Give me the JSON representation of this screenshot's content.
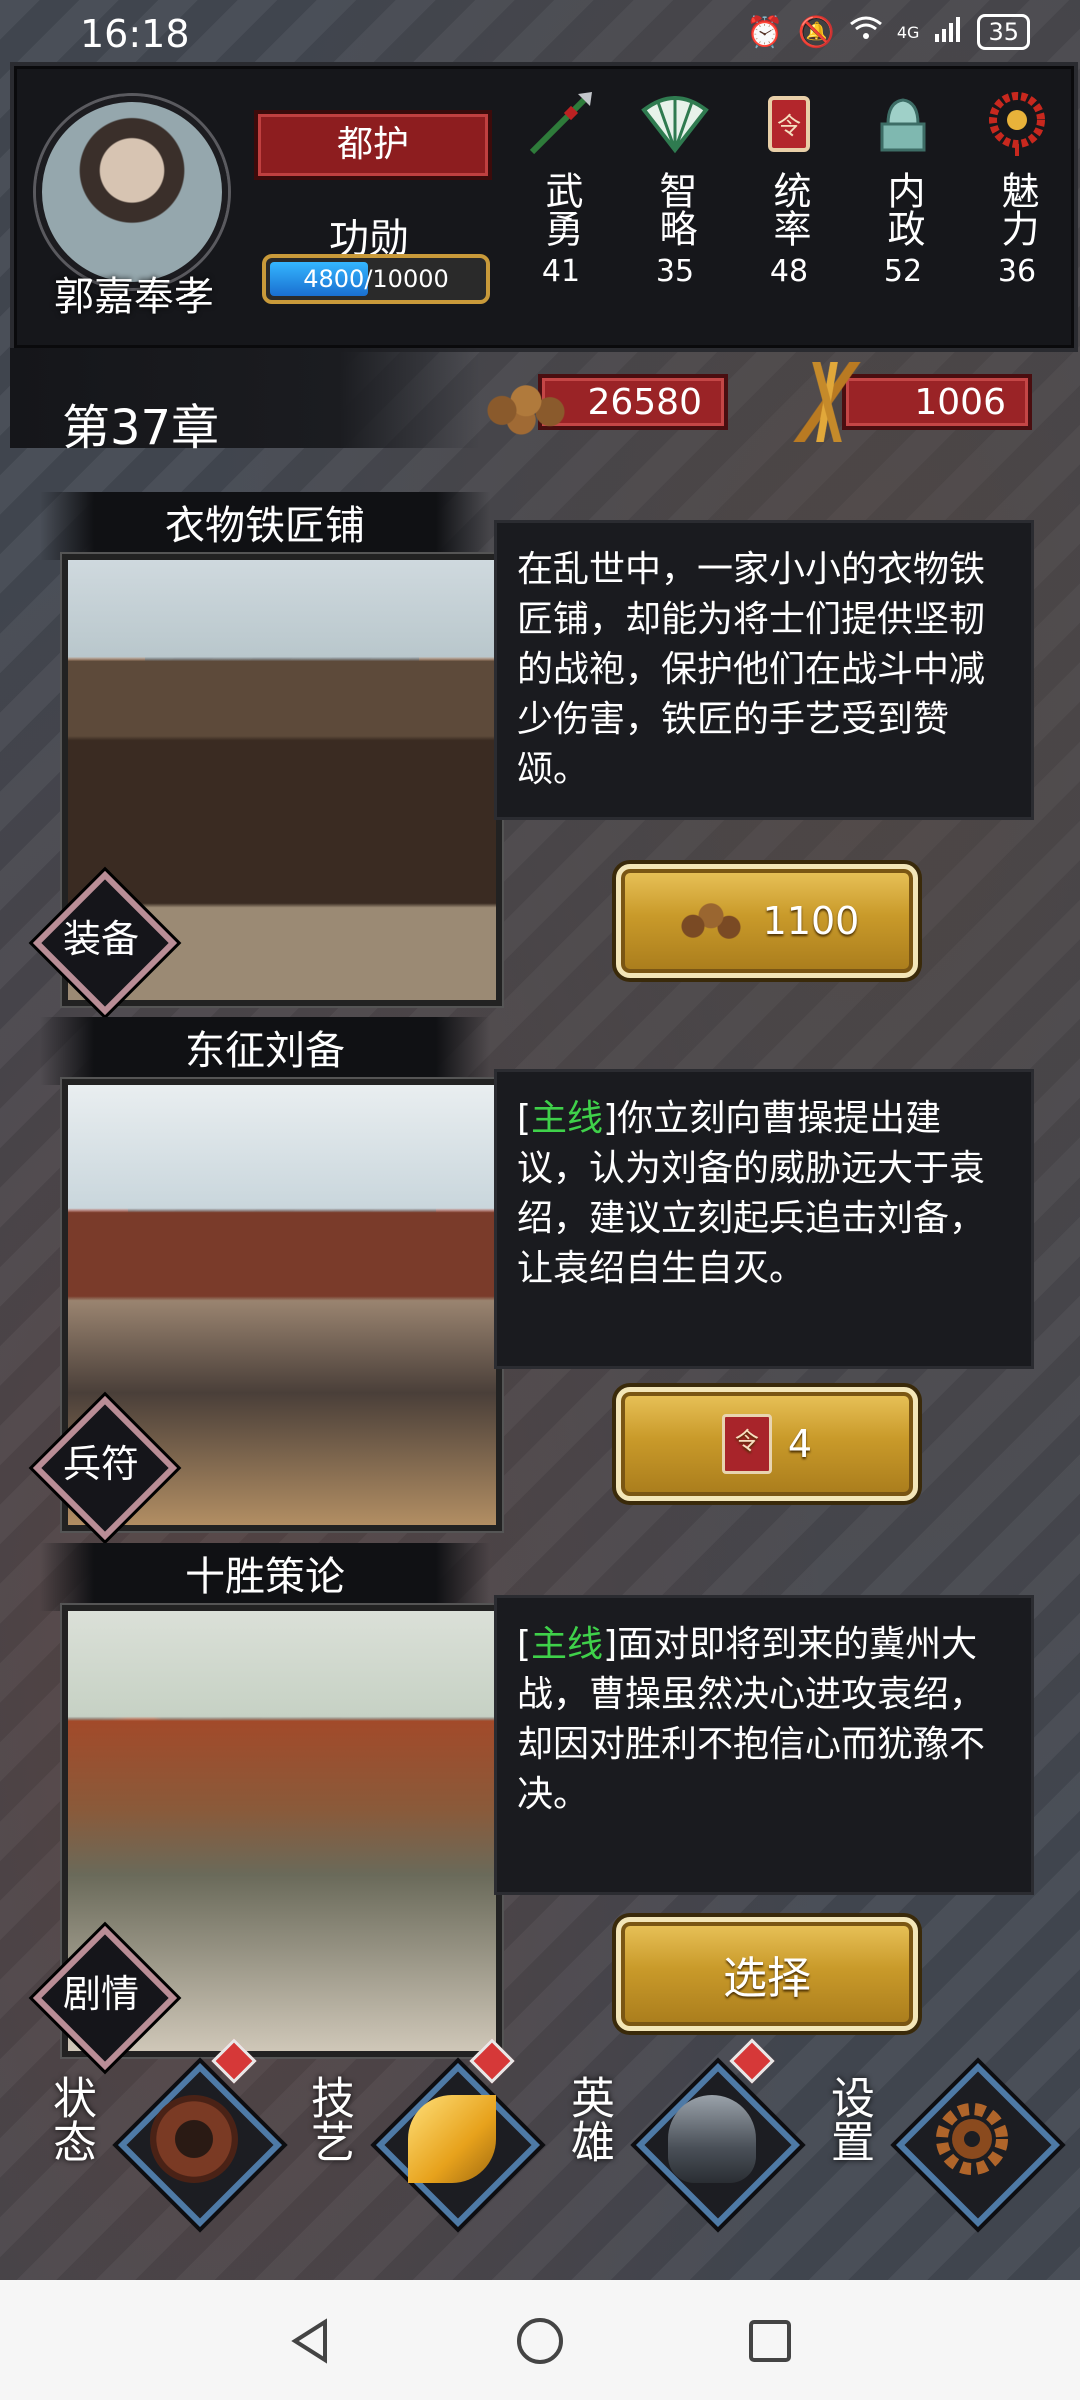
{
  "status_bar": {
    "time": "16:18",
    "network": "4G",
    "battery": "35"
  },
  "player": {
    "name": "郭嘉奉孝",
    "rank": "都护",
    "merit_label": "功勋",
    "merit_text": "4800/10000",
    "merit_progress": 0.48
  },
  "stats": [
    {
      "label": "武勇",
      "value": "41",
      "icon": "spear-icon"
    },
    {
      "label": "智略",
      "value": "35",
      "icon": "fan-icon"
    },
    {
      "label": "统率",
      "value": "48",
      "icon": "command-token-icon"
    },
    {
      "label": "内政",
      "value": "52",
      "icon": "seal-icon"
    },
    {
      "label": "魅力",
      "value": "36",
      "icon": "necklace-icon"
    }
  ],
  "chapter": {
    "title": "第37章"
  },
  "resources": {
    "coins": "26580",
    "grain": "1006"
  },
  "cards": [
    {
      "title": "衣物铁匠铺",
      "tag": "装备",
      "desc_prefix": "",
      "desc_tag": "",
      "desc_suffix": "",
      "description": "在乱世中，一家小小的衣物铁匠铺，却能为将士们提供坚韧的战袍，保护他们在战斗中减少伤害，铁匠的手艺受到赞颂。",
      "button": {
        "type": "coins",
        "label": "1100"
      }
    },
    {
      "title": "东征刘备",
      "tag": "兵符",
      "desc_prefix": "[",
      "desc_tag": "主线",
      "desc_suffix": "]",
      "description": "你立刻向曹操提出建议，认为刘备的威胁远大于袁绍，建议立刻起兵追击刘备，让袁绍自生自灭。",
      "button": {
        "type": "token",
        "label": "4",
        "token_glyph": "令"
      }
    },
    {
      "title": "十胜策论",
      "tag": "剧情",
      "desc_prefix": "[",
      "desc_tag": "主线",
      "desc_suffix": "]",
      "description": "面对即将到来的冀州大战，曹操虽然决心进攻袁绍，却因对胜利不抱信心而犹豫不决。",
      "button": {
        "type": "text",
        "label": "选择"
      }
    }
  ],
  "bottom_nav": [
    {
      "label": "状态",
      "icon": "dragon-medallion-icon",
      "badge": true
    },
    {
      "label": "技艺",
      "icon": "golden-leaf-icon",
      "badge": true
    },
    {
      "label": "英雄",
      "icon": "helmet-icon",
      "badge": true
    },
    {
      "label": "设置",
      "icon": "gear-icon",
      "badge": false
    }
  ],
  "colors": {
    "accent_gold": "#c99a2a",
    "badge_red": "#9a2326",
    "main_tag_green": "#3fd14a",
    "nav_blue": "#4e7aa6"
  }
}
